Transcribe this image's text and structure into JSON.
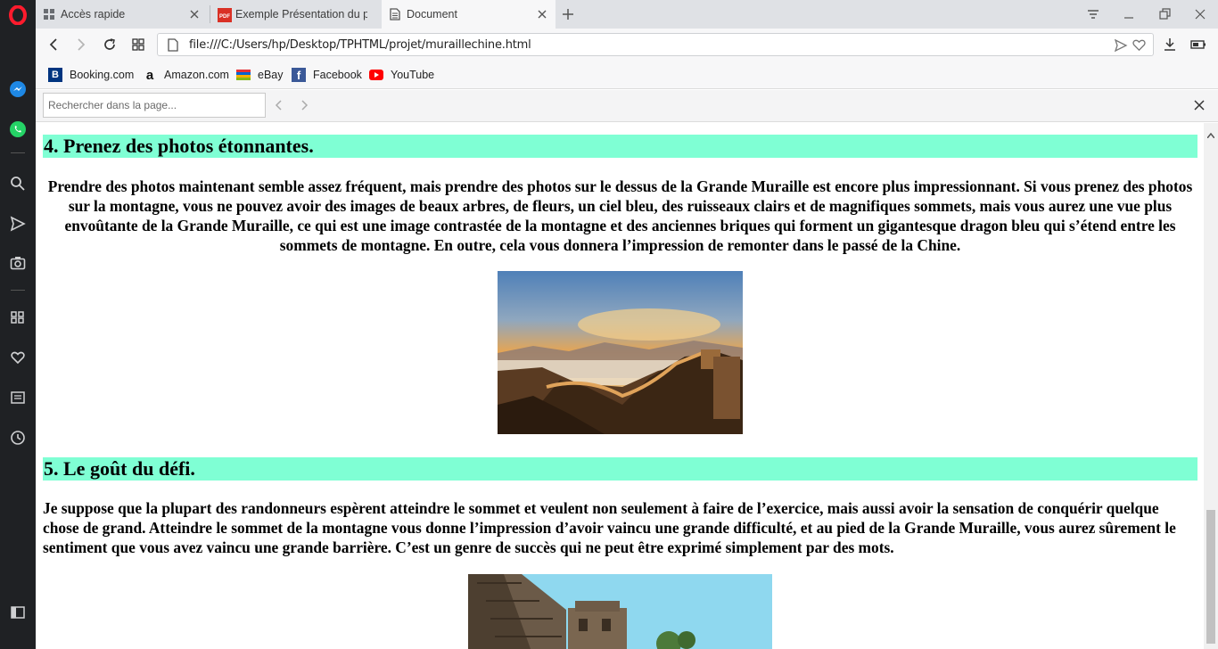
{
  "browser": {
    "tabs": [
      {
        "title": "Accès rapide",
        "icon": "speed-dial-icon",
        "active": false
      },
      {
        "title": "Exemple Présentation du p",
        "icon": "pdf-icon",
        "active": false
      },
      {
        "title": "Document",
        "icon": "document-icon",
        "active": true
      }
    ],
    "url": "file:///C:/Users/hp/Desktop/TPHTML/projet/muraillechine.html",
    "bookmarks": [
      {
        "label": "Booking.com",
        "icon": "booking-icon"
      },
      {
        "label": "Amazon.com",
        "icon": "amazon-icon"
      },
      {
        "label": "eBay",
        "icon": "ebay-icon"
      },
      {
        "label": "Facebook",
        "icon": "facebook-icon"
      },
      {
        "label": "YouTube",
        "icon": "youtube-icon"
      }
    ],
    "find": {
      "placeholder": "Rechercher dans la page..."
    },
    "colors": {
      "heading_bg": "#7fffd4",
      "sidebar": "#1f2124",
      "opera_red": "#ff1b2d"
    }
  },
  "content": {
    "section4": {
      "heading": "4. Prenez des photos étonnantes.",
      "paragraph": "Prendre des photos maintenant semble assez fréquent, mais prendre des photos sur le dessus de la Grande Muraille est encore plus impressionnant. Si vous prenez des photos sur la montagne, vous ne pouvez avoir des images de beaux arbres, de fleurs, un ciel bleu, des ruisseaux clairs et de magnifiques sommets, mais vous aurez une vue plus envoûtante de la Grande Muraille, ce qui est une image contrastée de la montagne et des anciennes briques qui forment un gigantesque dragon bleu qui s’étend entre les sommets de montagne. En outre, cela vous donnera l’impression de remonter dans le passé de la Chine."
    },
    "section5": {
      "heading": "5. Le goût du défi.",
      "paragraph": "Je suppose que la plupart des randonneurs espèrent atteindre le sommet et veulent non seulement à faire de l’exercice, mais aussi avoir la sensation de conquérir quelque chose de grand. Atteindre le sommet de la montagne vous donne l’impression d’avoir vaincu une grande difficulté, et au pied de la Grande Muraille, vous aurez sûrement le sentiment que vous avez vaincu une grande barrière. C’est un genre de succès qui ne peut être exprimé simplement par des mots."
    }
  }
}
